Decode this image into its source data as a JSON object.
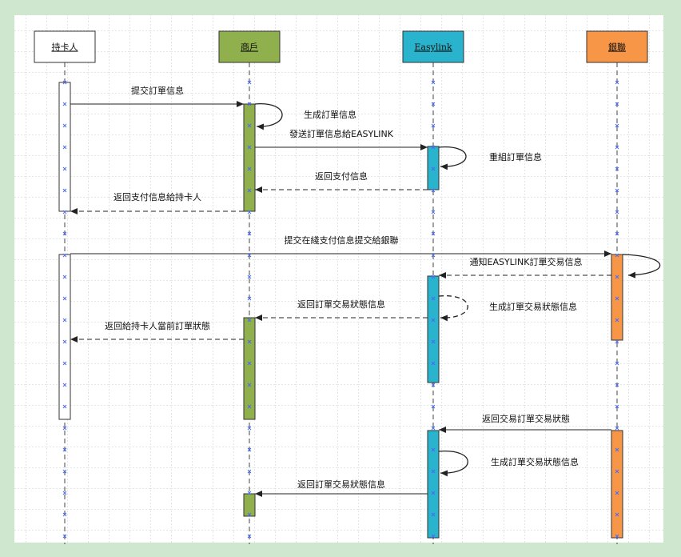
{
  "participants": [
    {
      "id": "cardholder",
      "label": "持卡人",
      "color": "#ffffff",
      "label_color": "#1a1a1a"
    },
    {
      "id": "merchant",
      "label": "商戶",
      "color": "#8fb04c",
      "label_color": "#1a1a1a"
    },
    {
      "id": "easylink",
      "label": "Easylink",
      "color": "#2ab3cc",
      "label_color": "#1a1a1a"
    },
    {
      "id": "unionpay",
      "label": "銀聯",
      "color": "#f79646",
      "label_color": "#1a1a1a"
    }
  ],
  "messages": [
    {
      "from": "cardholder",
      "to": "merchant",
      "label": "提交訂單信息",
      "style": "solid"
    },
    {
      "from": "merchant",
      "to": "merchant",
      "label": "生成訂單信息",
      "style": "solid"
    },
    {
      "from": "merchant",
      "to": "easylink",
      "label": "發送訂單信息給EASYLINK",
      "style": "solid"
    },
    {
      "from": "easylink",
      "to": "easylink",
      "label": "重組訂單信息",
      "style": "solid"
    },
    {
      "from": "easylink",
      "to": "merchant",
      "label": "返回支付信息",
      "style": "dashed"
    },
    {
      "from": "merchant",
      "to": "cardholder",
      "label": "返回支付信息給持卡人",
      "style": "dashed"
    },
    {
      "from": "cardholder",
      "to": "unionpay",
      "label": "提交在綫支付信息提交給銀聯",
      "style": "solid"
    },
    {
      "from": "unionpay",
      "to": "easylink",
      "label": "通知EASYLINK訂單交易信息",
      "style": "dashed"
    },
    {
      "from": "easylink",
      "to": "easylink",
      "label": "生成訂單交易狀態信息",
      "style": "dashed"
    },
    {
      "from": "easylink",
      "to": "merchant",
      "label": "返回訂單交易狀態信息",
      "style": "dashed"
    },
    {
      "from": "merchant",
      "to": "cardholder",
      "label": "返回給持卡人當前訂單狀態",
      "style": "dashed"
    },
    {
      "from": "unionpay",
      "to": "easylink",
      "label": "返回交易訂單交易狀態",
      "style": "solid"
    },
    {
      "from": "easylink",
      "to": "easylink",
      "label": "生成訂單交易狀態信息",
      "style": "solid"
    },
    {
      "from": "easylink",
      "to": "merchant",
      "label": "返回訂單交易狀態信息",
      "style": "solid"
    }
  ]
}
